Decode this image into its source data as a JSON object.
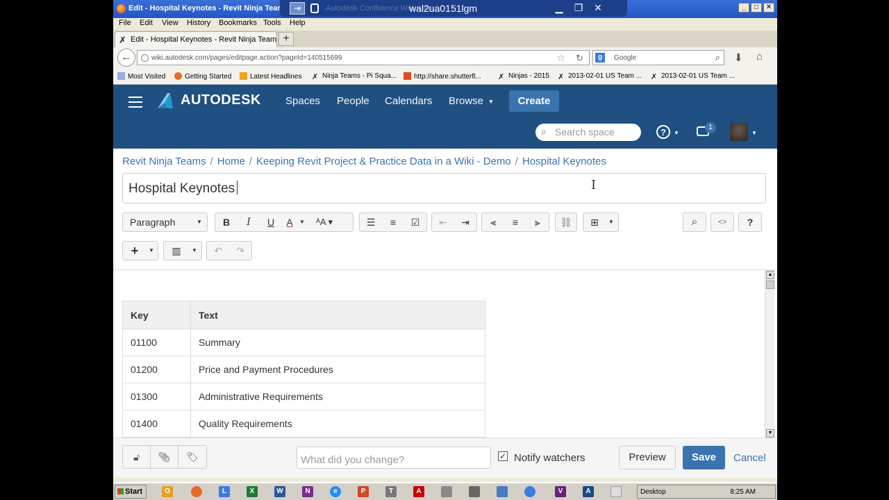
{
  "window": {
    "title": "Edit - Hospital Keynotes - Revit Ninja Teams - Mozilla Firefox",
    "rdp_host": "wal2ua0151lgm",
    "rdp_ghost_text": "Autodesk Confluence Wiki - Mo"
  },
  "menu": [
    "File",
    "Edit",
    "View",
    "History",
    "Bookmarks",
    "Tools",
    "Help"
  ],
  "tab": {
    "label": "Edit - Hospital Keynotes - Revit Ninja Teams ..."
  },
  "nav": {
    "url": "wiki.autodesk.com/pages/editpage.action?pageId=140515699",
    "search_placeholder": "Google",
    "search_engine_letter": "g"
  },
  "bookmarks": [
    "Most Visited",
    "Getting Started",
    "Latest Headlines",
    "Ninja Teams - Pi Squa...",
    "http://share.shutterfl...",
    "Ninjas - 2015",
    "2013-02-01 US Team ...",
    "2013-02-01 US Team ..."
  ],
  "header": {
    "brand": "AUTODESK",
    "links": [
      "Spaces",
      "People",
      "Calendars",
      "Browse"
    ],
    "create_label": "Create",
    "search_placeholder": "Search space",
    "help_symbol": "?",
    "notification_count": "1",
    "colors": {
      "bar": "#205081",
      "button": "#3b73af"
    }
  },
  "breadcrumb": [
    "Revit Ninja Teams",
    "Home",
    "Keeping Revit Project & Practice Data in a Wiki - Demo",
    "Hospital Keynotes"
  ],
  "page_title": "Hospital Keynotes",
  "toolbar": {
    "paragraph_label": "Paragraph",
    "bold": "B",
    "italic": "I",
    "underline": "U",
    "text_color": "A"
  },
  "table": {
    "headers": [
      "Key",
      "Text"
    ],
    "rows": [
      [
        "01100",
        "Summary"
      ],
      [
        "01200",
        "Price and Payment Procedures"
      ],
      [
        "01300",
        "Administrative Requirements"
      ],
      [
        "01400",
        "Quality Requirements"
      ]
    ]
  },
  "footer": {
    "comment_placeholder": "What did you change?",
    "notify_label": "Notify watchers",
    "notify_checked": true,
    "preview_label": "Preview",
    "save_label": "Save",
    "cancel_label": "Cancel"
  },
  "taskbar": {
    "start_label": "Start",
    "desktop_label": "Desktop",
    "clock": "8:25 AM"
  }
}
